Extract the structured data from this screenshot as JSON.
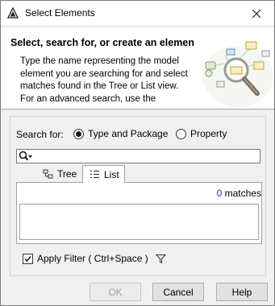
{
  "window": {
    "title": "Select Elements",
    "icons": {
      "app": "app-logo-icon",
      "close": "close-icon"
    }
  },
  "header": {
    "title": "Select, search for, or create an elemen",
    "description": "Type the name representing the model element you are searching for and select matches found in the Tree or List view. For an advanced search, use the",
    "art": "search-magnifier-illustration"
  },
  "search": {
    "label": "Search for:",
    "options": [
      {
        "label": "Type and Package",
        "selected": true
      },
      {
        "label": "Property",
        "selected": false
      }
    ],
    "value": "",
    "icon": "search-dropdown-icon"
  },
  "tabs": [
    {
      "label": "Tree",
      "icon": "tree-icon",
      "active": false
    },
    {
      "label": "List",
      "icon": "list-icon",
      "active": true
    }
  ],
  "results": {
    "count": "0",
    "suffix": "matches",
    "items": []
  },
  "filter": {
    "label": "Apply Filter ( Ctrl+Space )",
    "checked": true,
    "icon": "filter-funnel-icon"
  },
  "buttons": {
    "ok": "OK",
    "cancel": "Cancel",
    "help": "Help"
  }
}
